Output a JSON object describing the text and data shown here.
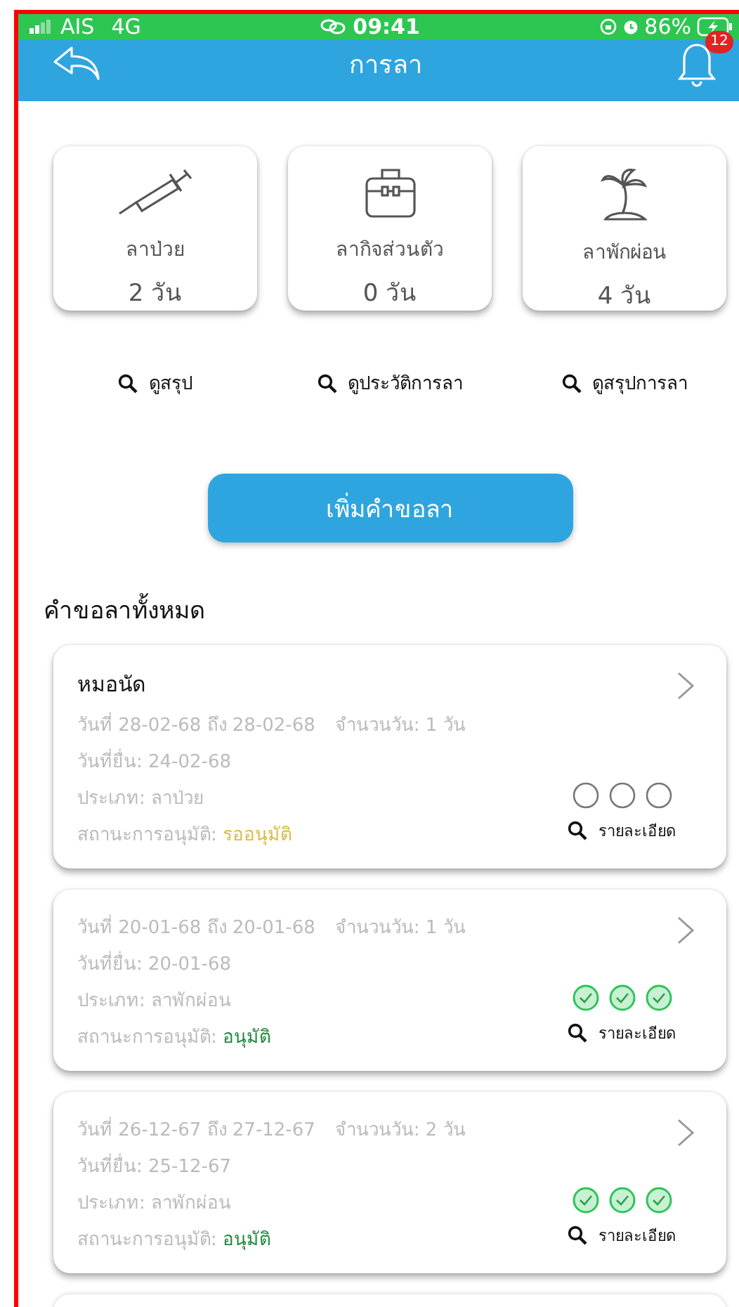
{
  "status_bar": {
    "carrier": "AIS",
    "network": "4G",
    "time": "09:41",
    "battery": "86%"
  },
  "header": {
    "title": "การลา",
    "notification_count": "12"
  },
  "leave_balances": [
    {
      "kind": "sick",
      "label": "ลาป่วย",
      "days": "2 วัน"
    },
    {
      "kind": "personal",
      "label": "ลากิจส่วนตัว",
      "days": "0 วัน"
    },
    {
      "kind": "vacation",
      "label": "ลาพักผ่อน",
      "days": "4 วัน"
    }
  ],
  "links": [
    "ดูสรุป",
    "ดูประวัติการลา",
    "ดูสรุปการลา"
  ],
  "add_button": "เพิ่มคำขอลา",
  "section_title": "คำขอลาทั้งหมด",
  "requests": [
    {
      "title": "หมอนัด",
      "dates": "วันที่ 28-02-68 ถึง 28-02-68",
      "days": "จำนวนวัน: 1 วัน",
      "submitted": "วันที่ยื่น: 24-02-68",
      "type": "ประเภท: ลาป่วย",
      "status_label": "สถานะการอนุมัติ:",
      "status": "รออนุมัติ",
      "approved": false,
      "approvals": [
        {
          "approved": false
        },
        {
          "approved": false
        },
        {
          "approved": false
        }
      ],
      "detail": "รายละเอียด"
    },
    {
      "dates": "วันที่ 20-01-68 ถึง 20-01-68",
      "days": "จำนวนวัน: 1 วัน",
      "submitted": "วันที่ยื่น: 20-01-68",
      "type": "ประเภท: ลาพักผ่อน",
      "status_label": "สถานะการอนุมัติ:",
      "status": "อนุมัติ",
      "approved": true,
      "approvals": [
        {
          "approved": true
        },
        {
          "approved": true
        },
        {
          "approved": true
        }
      ],
      "detail": "รายละเอียด"
    },
    {
      "dates": "วันที่ 26-12-67 ถึง 27-12-67",
      "days": "จำนวนวัน: 2 วัน",
      "submitted": "วันที่ยื่น: 25-12-67",
      "type": "ประเภท: ลาพักผ่อน",
      "status_label": "สถานะการอนุมัติ:",
      "status": "อนุมัติ",
      "approved": true,
      "approvals": [
        {
          "approved": true
        },
        {
          "approved": true
        },
        {
          "approved": true
        }
      ],
      "detail": "รายละเอียด"
    }
  ]
}
